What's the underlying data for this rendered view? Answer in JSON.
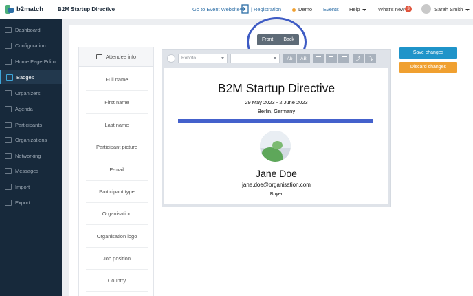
{
  "app": {
    "logo": "b2match",
    "title": "B2M Startup Directive"
  },
  "topnav": {
    "event_website": "Go to Event Website",
    "registration": "Registration",
    "demo": "Demo",
    "events": "Events",
    "help": "Help",
    "whats_new": "What's new",
    "whats_new_count": "3",
    "user": "Sarah Smith"
  },
  "sidebar": {
    "items": [
      {
        "label": "Dashboard",
        "icon": "dashboard-icon"
      },
      {
        "label": "Configuration",
        "icon": "configuration-icon"
      },
      {
        "label": "Home Page Editor",
        "icon": "home-page-editor-icon"
      },
      {
        "label": "Badges",
        "icon": "badges-icon",
        "active": true
      },
      {
        "label": "Organizers",
        "icon": "organizers-icon"
      },
      {
        "label": "Agenda",
        "icon": "agenda-icon"
      },
      {
        "label": "Participants",
        "icon": "participants-icon"
      },
      {
        "label": "Organizations",
        "icon": "organizations-icon"
      },
      {
        "label": "Networking",
        "icon": "networking-icon"
      },
      {
        "label": "Messages",
        "icon": "messages-icon"
      },
      {
        "label": "Import",
        "icon": "import-icon"
      },
      {
        "label": "Export",
        "icon": "export-icon"
      }
    ]
  },
  "toggle": {
    "front": "Front",
    "back": "Back"
  },
  "attendee": {
    "heading": "Attendee info",
    "fields": [
      "Full name",
      "First name",
      "Last name",
      "Participant picture",
      "E-mail",
      "Participant type",
      "Organisation",
      "Organisation logo",
      "Job position",
      "Country"
    ]
  },
  "toolbar": {
    "font": "Roboto",
    "size": "",
    "btn_upper": "Ab",
    "btn_lower": "AB"
  },
  "badge": {
    "title": "B2M Startup Directive",
    "dates": "29 May 2023 - 2 June 2023",
    "location": "Berlin, Germany",
    "name": "Jane Doe",
    "email": "jane.doe@organisation.com",
    "role": "Buyer"
  },
  "actions": {
    "save": "Save changes",
    "discard": "Discard changes"
  },
  "colors": {
    "sidebar": "#17293b",
    "accent_blue": "#1f94c9",
    "discard_orange": "#f0a030",
    "badge_bar": "#4461cc",
    "highlight_circle": "#3e5bc4"
  }
}
